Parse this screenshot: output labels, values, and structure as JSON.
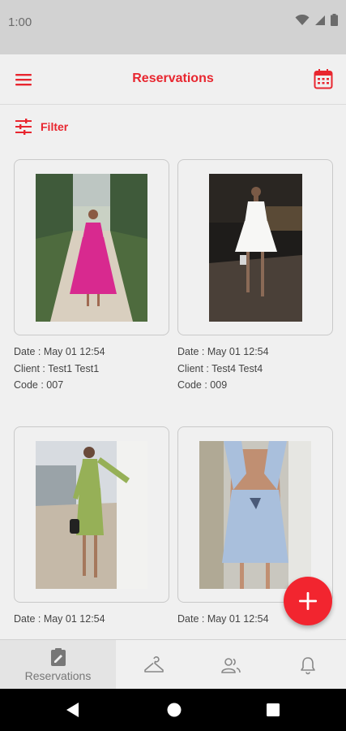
{
  "status_bar": {
    "time": "1:00"
  },
  "app_bar": {
    "title": "Reservations",
    "menu_icon": "menu-icon",
    "calendar_icon": "calendar-icon"
  },
  "filter": {
    "label": "Filter",
    "icon": "sliders-icon"
  },
  "reservations": [
    {
      "date": "Date : May 01 12:54",
      "client": "Client : Test1 Test1",
      "code": "Code : 007",
      "dress_color": "#d8298f"
    },
    {
      "date": "Date : May 01 12:54",
      "client": "Client : Test4 Test4",
      "code": "Code : 009",
      "dress_color": "#f7f7f5"
    },
    {
      "date": "Date : May 01 12:54",
      "client": "",
      "code": "",
      "dress_color": "#96b057"
    },
    {
      "date": "Date : May 01 12:54",
      "client": "",
      "code": "",
      "dress_color": "#a9bfdc"
    }
  ],
  "fab": {
    "icon": "plus-icon"
  },
  "bottom_nav": {
    "items": [
      {
        "label": "Reservations",
        "icon": "clipboard-edit-icon",
        "active": true
      },
      {
        "label": "",
        "icon": "hanger-icon",
        "active": false
      },
      {
        "label": "",
        "icon": "users-icon",
        "active": false
      },
      {
        "label": "",
        "icon": "bell-icon",
        "active": false
      }
    ]
  },
  "colors": {
    "accent": "#e8262f",
    "fab": "#f2252f",
    "background": "#f0f0f0"
  }
}
